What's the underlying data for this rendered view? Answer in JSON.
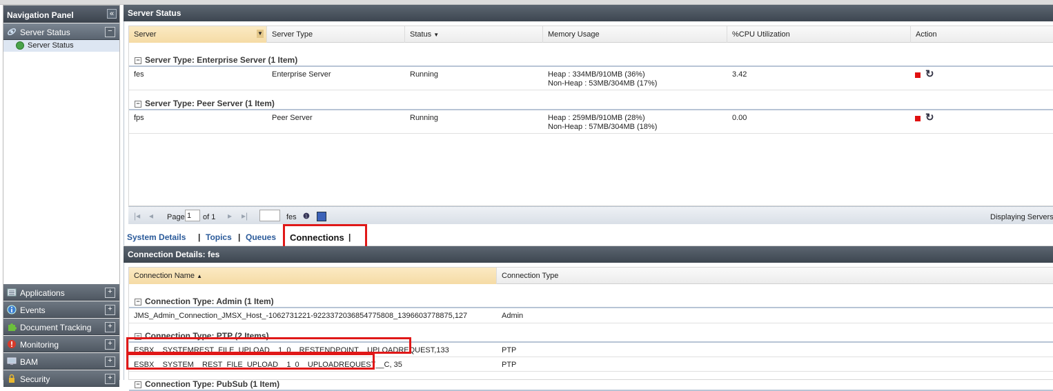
{
  "nav": {
    "title": "Navigation Panel",
    "collapse_icon": "double-chevron-left-icon",
    "sections": [
      {
        "label": "Server Status",
        "icon": "satellite-icon",
        "toggle": "−",
        "expanded": true
      },
      {
        "label": "Applications",
        "icon": "list-icon",
        "toggle": "+"
      },
      {
        "label": "Events",
        "icon": "info-icon",
        "toggle": "+"
      },
      {
        "label": "Document Tracking",
        "icon": "puzzle-icon",
        "toggle": "+"
      },
      {
        "label": "Monitoring",
        "icon": "alert-icon",
        "toggle": "+"
      },
      {
        "label": "BAM",
        "icon": "monitor-icon",
        "toggle": "+"
      },
      {
        "label": "Security",
        "icon": "lock-icon",
        "toggle": "+"
      }
    ],
    "tree_item": "Server Status"
  },
  "server_status": {
    "title": "Server Status",
    "columns": [
      "Server",
      "Server Type",
      "Status",
      "Memory Usage",
      "%CPU Utilization",
      "Action"
    ],
    "groups": [
      {
        "label": "Server Type: Enterprise Server (1 Item)",
        "rows": [
          {
            "server": "fes",
            "type": "Enterprise Server",
            "status": "Running",
            "heap": "Heap : 334MB/910MB (36%)",
            "nonheap": "Non-Heap : 53MB/304MB (17%)",
            "cpu": "3.42"
          }
        ]
      },
      {
        "label": "Server Type: Peer Server (1 Item)",
        "rows": [
          {
            "server": "fps",
            "type": "Peer Server",
            "status": "Running",
            "heap": "Heap : 259MB/910MB (28%)",
            "nonheap": "Non-Heap : 57MB/304MB (18%)",
            "cpu": "0.00"
          }
        ]
      }
    ],
    "pager": {
      "page_label": "Page",
      "page_value": "1",
      "of_label": "of 1",
      "server_value": "fes",
      "displaying": "Displaying Servers"
    }
  },
  "tabs": {
    "system_details": "System Details",
    "topics": "Topics",
    "queues": "Queues",
    "connections": "Connections",
    "sep": "|"
  },
  "connection_details": {
    "title": "Connection Details: fes",
    "columns": [
      "Connection Name",
      "Connection Type"
    ],
    "groups": [
      {
        "label": "Connection Type: Admin (1 Item)",
        "rows": [
          {
            "name": "JMS_Admin_Connection_JMSX_Host_-1062731221-9223372036854775808_1396603778875,127",
            "type": "Admin"
          }
        ]
      },
      {
        "label": "Connection Type: PTP (2 Items)",
        "rows": [
          {
            "name": "ESBX__SYSTEMREST_FILE_UPLOAD__1_0__RESTENDPOINT__UPLOADREQUEST,133",
            "type": "PTP"
          },
          {
            "name": "ESBX__SYSTEM__REST_FILE_UPLOAD__1_0__UPLOADREQUEST__C, 35",
            "type": "PTP"
          }
        ]
      },
      {
        "label": "Connection Type: PubSub (1 Item)",
        "rows": []
      }
    ]
  },
  "colors": {
    "highlight": "#e01818",
    "header_dark": "#3d4650",
    "sorted_col": "#f5dba5",
    "link": "#2a5a9a"
  }
}
